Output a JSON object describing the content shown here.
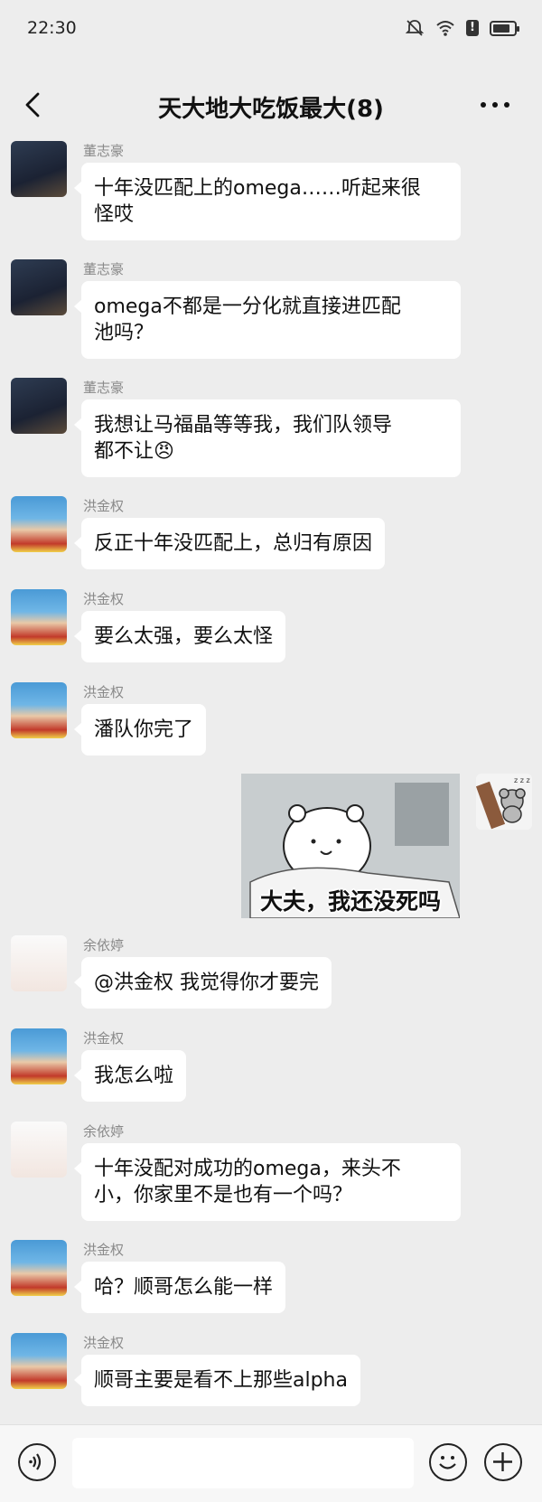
{
  "status_bar": {
    "time": "22:30",
    "icons": [
      "bell-muted-icon",
      "wifi-icon",
      "alert-icon",
      "battery-icon"
    ]
  },
  "nav": {
    "title": "天大地大吃饭最大(8)",
    "back_icon": "chevron-left-icon",
    "more_icon": "more-horizontal-icon"
  },
  "messages": [
    {
      "sender": "董志豪",
      "text": "十年没匹配上的omega……听起来很怪哎",
      "line1": "十年没匹配上的omega……听起来很",
      "line2": "怪哎"
    },
    {
      "sender": "董志豪",
      "text": "omega不都是一分化就直接进匹配池吗？",
      "line1": "omega不都是一分化就直接进匹配",
      "line2": "池吗？"
    },
    {
      "sender": "董志豪",
      "text": "我想让马福晶等等我，我们队领导都不让😠",
      "line1": "我想让马福晶等等我，我们队领导",
      "line2": "都不让😠"
    },
    {
      "sender": "洪金权",
      "text": "反正十年没匹配上，总归有原因"
    },
    {
      "sender": "洪金权",
      "text": "要么太强，要么太怪"
    },
    {
      "sender": "洪金权",
      "text": "潘队你完了"
    },
    {
      "sender": "余依婷",
      "text": "@洪金权 我觉得你才要完"
    },
    {
      "sender": "洪金权",
      "text": "我怎么啦"
    },
    {
      "sender": "余依婷",
      "text": "十年没配对成功的omega，来头不小，你家里不是也有一个吗？",
      "line1": "十年没配对成功的omega，来头不",
      "line2": "小，你家里不是也有一个吗？"
    },
    {
      "sender": "洪金权",
      "text": "哈？顺哥怎么能一样"
    },
    {
      "sender": "洪金权",
      "text": "顺哥主要是看不上那些alpha"
    }
  ],
  "sticker": {
    "caption": "大夫，我还没死吗"
  },
  "input_bar": {
    "voice_icon": "voice-icon",
    "emoji_icon": "emoji-icon",
    "plus_icon": "plus-icon"
  }
}
